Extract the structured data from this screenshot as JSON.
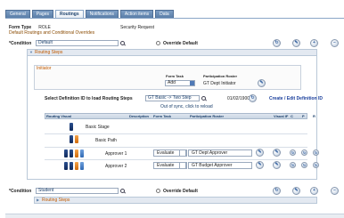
{
  "tabs": [
    "General",
    "Pages",
    "Routings",
    "Notifications",
    "Action items",
    "Data"
  ],
  "header": {
    "form_type_label": "Form Type",
    "form_type_value": "ROLE",
    "request_type": "Security Request",
    "section_title": "Default Routings and Conditional Overrides"
  },
  "condition1": {
    "label": "*Condition",
    "value": "Default",
    "override_label": "Override Default",
    "routing_steps_title": "Routing Steps",
    "initiator": {
      "title": "Initiator",
      "form_task_label": "Form Task",
      "form_task_value": "Add",
      "participation_label": "Participation Roster",
      "participation_value": "GT Dept Initiator"
    },
    "load_label": "Select Definition ID to load Routing Steps",
    "definition_value": "GT Basic -> Two Step",
    "definition_date": "01/02/1900",
    "create_edit_link": "Create / Edit Definition ID",
    "sync_message": "Out of sync, click to reload",
    "grid": {
      "headers": {
        "visual": "Routing Visual",
        "description": "Description",
        "form_task": "Form Task",
        "roster": "Participation Roster",
        "visual_if": "Visual IF",
        "c": "C",
        "p": "P",
        "r": "R"
      },
      "rows": [
        {
          "description": "Basic Stage",
          "form_task": "",
          "roster": ""
        },
        {
          "description": "Basic Path",
          "form_task": "",
          "roster": ""
        },
        {
          "description": "Approver 1",
          "form_task": "Evaluate",
          "roster": "GT Dept Approver"
        },
        {
          "description": "Approver 2",
          "form_task": "Evaluate",
          "roster": "GT Budget Approver"
        }
      ]
    }
  },
  "condition2": {
    "label": "*Condition",
    "value": "Student",
    "override_label": "Override Default",
    "routing_steps_title": "Routing Steps"
  },
  "icons": {
    "row_plus": "+",
    "row_minus": "−",
    "edit": "✎",
    "reload": "↻"
  },
  "colors": {
    "tab_bg": "#5a7ea8",
    "section_title": "#8a4a00",
    "panel_title": "#c05a00",
    "link": "#1a3f9c"
  }
}
